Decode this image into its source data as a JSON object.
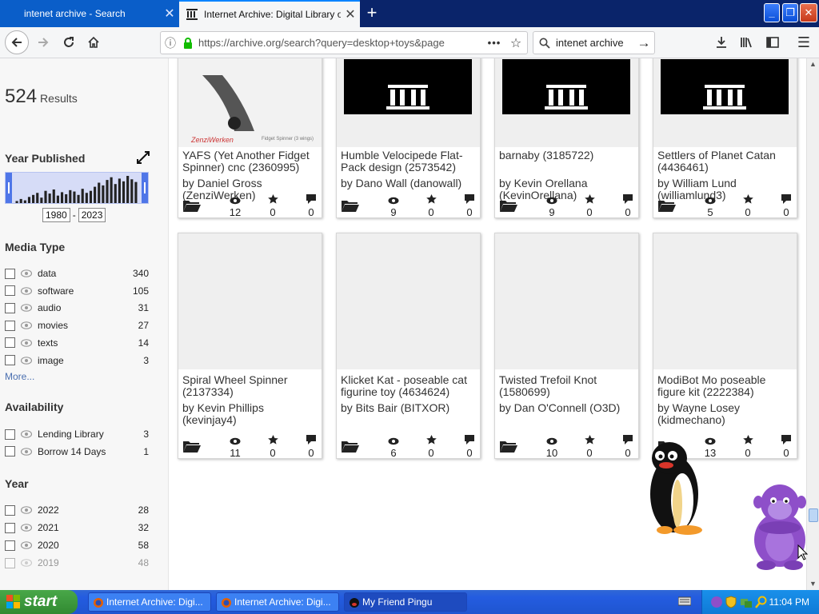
{
  "browser": {
    "tabs": [
      {
        "label": "intenet archive - Search",
        "active": false
      },
      {
        "label": "Internet Archive: Digital Library of",
        "active": true
      }
    ],
    "url": "https://archive.org/search?query=desktop+toys&page",
    "search_value": "intenet archive"
  },
  "page": {
    "results_count": "524",
    "results_label": "Results",
    "year_published": {
      "heading": "Year Published",
      "from": "1980",
      "to": "2023",
      "separator": "-"
    },
    "media_type": {
      "heading": "Media Type",
      "items": [
        {
          "label": "data",
          "count": "340"
        },
        {
          "label": "software",
          "count": "105"
        },
        {
          "label": "audio",
          "count": "31"
        },
        {
          "label": "movies",
          "count": "27"
        },
        {
          "label": "texts",
          "count": "14"
        },
        {
          "label": "image",
          "count": "3"
        }
      ],
      "more": "More..."
    },
    "availability": {
      "heading": "Availability",
      "items": [
        {
          "label": "Lending Library",
          "count": "3"
        },
        {
          "label": "Borrow 14 Days",
          "count": "1"
        }
      ]
    },
    "year": {
      "heading": "Year",
      "items": [
        {
          "label": "2022",
          "count": "28"
        },
        {
          "label": "2021",
          "count": "32"
        },
        {
          "label": "2020",
          "count": "58"
        },
        {
          "label": "2019",
          "count": "48"
        }
      ]
    },
    "thumb_caption": {
      "brand": "ZenziWerken",
      "product": "Fidget Spinner (3 wings)"
    },
    "results": [
      {
        "title": "YAFS (Yet Another Fidget Spinner) cnc (2360995)",
        "creator": "by Daniel Gross (ZenziWerken)",
        "views": "12",
        "favs": "0",
        "reviews": "0"
      },
      {
        "title": "Humble Velocipede Flat-Pack design (2573542)",
        "creator": "by Dano Wall (danowall)",
        "views": "9",
        "favs": "0",
        "reviews": "0"
      },
      {
        "title": "barnaby (3185722)",
        "creator": "by Kevin Orellana (KevinOrellana)",
        "views": "9",
        "favs": "0",
        "reviews": "0"
      },
      {
        "title": "Settlers of Planet Catan (4436461)",
        "creator": "by William Lund (williamlund3)",
        "views": "5",
        "favs": "0",
        "reviews": "0"
      },
      {
        "title": "Spiral Wheel Spinner (2137334)",
        "creator": "by Kevin Phillips (kevinjay4)",
        "views": "11",
        "favs": "0",
        "reviews": "0"
      },
      {
        "title": "Klicket Kat - poseable cat figurine toy (4634624)",
        "creator": "by Bits Bair (BITXOR)",
        "views": "6",
        "favs": "0",
        "reviews": "0"
      },
      {
        "title": "Twisted Trefoil Knot (1580699)",
        "creator": "by Dan O'Connell (O3D)",
        "views": "10",
        "favs": "0",
        "reviews": "0"
      },
      {
        "title": "ModiBot Mo poseable figure kit (2222384)",
        "creator": "by Wayne Losey (kidmechano)",
        "views": "13",
        "favs": "0",
        "reviews": "0"
      }
    ],
    "histogram_bars": [
      3,
      6,
      4,
      9,
      12,
      15,
      8,
      18,
      14,
      20,
      11,
      16,
      13,
      19,
      17,
      12,
      21,
      15,
      18,
      24,
      30,
      26,
      34,
      38,
      28,
      36,
      32,
      40,
      35,
      31
    ],
    "histogram_max": 40
  },
  "taskbar": {
    "start": "start",
    "tasks": [
      {
        "label": "Internet Archive: Digi...",
        "active": false
      },
      {
        "label": "Internet Archive: Digi...",
        "active": false
      },
      {
        "label": "My Friend Pingu",
        "active": true
      }
    ],
    "clock": "11:04 PM"
  }
}
